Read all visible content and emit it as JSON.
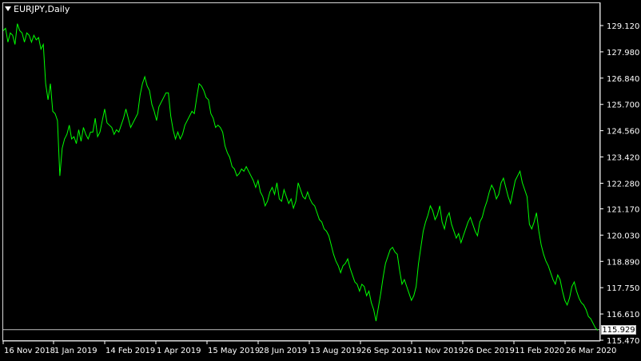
{
  "window": {
    "symbol_title": "EURJPY,Daily"
  },
  "colors": {
    "background": "#000000",
    "line": "#00ff00",
    "grid_frame": "#d8d8d8",
    "text": "#ffffff",
    "current_price_line": "#c0c0c0"
  },
  "current_price": "115.929",
  "chart_data": {
    "type": "line",
    "title": "EURJPY,Daily",
    "xlabel": "",
    "ylabel": "",
    "y_ticks": [
      "129.120",
      "127.980",
      "126.840",
      "125.700",
      "124.560",
      "123.420",
      "122.280",
      "121.170",
      "120.030",
      "118.890",
      "117.750",
      "116.610",
      "115.470"
    ],
    "x_ticks": [
      "16 Nov 2018",
      "1 Jan 2019",
      "14 Feb 2019",
      "1 Apr 2019",
      "15 May 2019",
      "28 Jun 2019",
      "13 Aug 2019",
      "26 Sep 2019",
      "11 Nov 2019",
      "26 Dec 2019",
      "11 Feb 2020",
      "26 Mar 2020"
    ],
    "ylim": [
      115.47,
      129.12
    ],
    "grid": false,
    "series": [
      {
        "values": [
          128.9,
          129.0,
          128.4,
          128.8,
          128.7,
          128.3,
          129.2,
          128.9,
          128.8,
          128.4,
          128.8,
          128.7,
          128.4,
          128.7,
          128.5,
          128.6,
          128.1,
          128.3,
          126.6,
          125.9,
          126.6,
          125.4,
          125.3,
          125.0,
          122.6,
          123.8,
          124.2,
          124.4,
          124.8,
          124.2,
          124.3,
          124.0,
          124.6,
          124.1,
          124.7,
          124.4,
          124.2,
          124.5,
          124.5,
          125.1,
          124.3,
          124.5,
          125.0,
          125.5,
          124.9,
          124.8,
          124.7,
          124.4,
          124.6,
          124.5,
          124.8,
          125.1,
          125.5,
          125.1,
          124.7,
          124.9,
          125.1,
          125.3,
          126.1,
          126.6,
          126.9,
          126.5,
          126.3,
          125.7,
          125.4,
          125.0,
          125.6,
          125.8,
          126.0,
          126.2,
          126.2,
          125.2,
          124.6,
          124.2,
          124.5,
          124.2,
          124.4,
          124.8,
          125.0,
          125.2,
          125.4,
          125.3,
          126.0,
          126.6,
          126.5,
          126.3,
          126.0,
          125.9,
          125.3,
          125.1,
          124.7,
          124.8,
          124.7,
          124.5,
          123.9,
          123.6,
          123.4,
          123.0,
          122.9,
          122.6,
          122.7,
          122.9,
          122.8,
          123.0,
          122.8,
          122.6,
          122.4,
          122.1,
          122.4,
          121.9,
          121.7,
          121.3,
          121.5,
          121.9,
          122.1,
          121.8,
          122.3,
          121.6,
          121.5,
          122.0,
          121.7,
          121.4,
          121.6,
          121.2,
          121.5,
          122.3,
          122.0,
          121.7,
          121.6,
          121.9,
          121.6,
          121.4,
          121.3,
          121.0,
          120.7,
          120.6,
          120.3,
          120.2,
          120.0,
          119.6,
          119.2,
          118.9,
          118.7,
          118.4,
          118.7,
          118.8,
          119.0,
          118.6,
          118.3,
          118.0,
          117.9,
          117.6,
          117.9,
          117.8,
          117.4,
          117.6,
          117.1,
          116.8,
          116.3,
          116.9,
          117.5,
          118.2,
          118.8,
          119.1,
          119.4,
          119.5,
          119.3,
          119.2,
          118.5,
          117.9,
          118.1,
          117.8,
          117.5,
          117.2,
          117.4,
          117.8,
          118.8,
          119.5,
          120.2,
          120.6,
          120.9,
          121.3,
          121.1,
          120.7,
          120.9,
          121.3,
          120.6,
          120.3,
          120.8,
          121.0,
          120.5,
          120.2,
          119.9,
          120.1,
          119.7,
          120.0,
          120.3,
          120.6,
          120.8,
          120.5,
          120.2,
          120.0,
          120.6,
          120.8,
          121.2,
          121.5,
          121.9,
          122.2,
          122.0,
          121.6,
          121.8,
          122.3,
          122.5,
          122.1,
          121.7,
          121.4,
          121.9,
          122.4,
          122.6,
          122.8,
          122.3,
          122.0,
          121.7,
          120.5,
          120.3,
          120.6,
          121.0,
          120.2,
          119.6,
          119.2,
          118.9,
          118.7,
          118.4,
          118.1,
          117.9,
          118.3,
          118.1,
          117.6,
          117.2,
          117.0,
          117.3,
          117.8,
          118.0,
          117.6,
          117.3,
          117.1,
          117.0,
          116.8,
          116.5,
          116.4,
          116.2,
          116.0,
          115.9
        ],
        "display_values": [
          128.9,
          129.0,
          128.4,
          128.8,
          128.7,
          128.3,
          129.2,
          128.9,
          128.8,
          128.4,
          128.8,
          128.7,
          128.4,
          128.7,
          128.5,
          128.6,
          128.1,
          128.3,
          126.6,
          125.9,
          126.6,
          125.4,
          125.3,
          125.0,
          122.6,
          123.8,
          124.2,
          124.4,
          124.8,
          124.2,
          124.3,
          124.0,
          124.6,
          124.1,
          124.7,
          124.4,
          124.2,
          124.5,
          124.5,
          125.1,
          124.3,
          124.5,
          125.0,
          125.5,
          124.9,
          124.8,
          124.7,
          124.4,
          124.6,
          124.5,
          124.8,
          125.1,
          125.5,
          125.1,
          124.7,
          124.9,
          125.1,
          125.3,
          126.1,
          126.6,
          126.9,
          126.5,
          126.3,
          125.7,
          125.4,
          125.0,
          125.6,
          125.8,
          126.0,
          126.2,
          126.2,
          125.2,
          124.6,
          124.2,
          124.5,
          124.2,
          124.4,
          124.8,
          125.0,
          125.2,
          125.4,
          125.3,
          126.0,
          126.6,
          126.5,
          126.3,
          126.0,
          125.9,
          125.3,
          125.1,
          124.7,
          124.8,
          124.7,
          124.5,
          123.9,
          123.6,
          123.4,
          123.0,
          122.9,
          122.6,
          122.7,
          122.9,
          122.8,
          123.0,
          122.8,
          122.6,
          122.4,
          122.1,
          122.4,
          121.9,
          121.7,
          121.3,
          121.5,
          121.9,
          122.1,
          121.8,
          122.3,
          121.6,
          121.5,
          122.0,
          121.7,
          121.4,
          121.6,
          121.2,
          121.5,
          122.3,
          122.0,
          121.7,
          121.6,
          121.9,
          121.6,
          121.4,
          121.3,
          121.0,
          120.7,
          120.6,
          120.3,
          120.2,
          120.0,
          119.6,
          119.2,
          118.9,
          118.7,
          118.4,
          118.7,
          118.8,
          119.0,
          118.6,
          118.3,
          118.0,
          117.9,
          117.6,
          117.9,
          117.8,
          117.4,
          117.6,
          117.1,
          116.8,
          116.3,
          116.9,
          117.5,
          118.2,
          118.8,
          119.1,
          119.4,
          119.5,
          119.3,
          119.2,
          118.5,
          117.9,
          118.1,
          117.8,
          117.5,
          117.2,
          117.4,
          117.8,
          118.8,
          119.5,
          120.2,
          120.6,
          120.9,
          121.3,
          121.1,
          120.7,
          120.9,
          121.3,
          120.6,
          120.3,
          120.8,
          121.0,
          120.5,
          120.2,
          119.9,
          120.1,
          119.7,
          120.0,
          120.3,
          120.6,
          120.8,
          120.5,
          120.2,
          120.0,
          120.6,
          120.8,
          121.2,
          121.5,
          121.9,
          122.2,
          122.0,
          121.6,
          121.8,
          122.3,
          122.5,
          122.1,
          121.7,
          121.4,
          121.9,
          122.4,
          122.6,
          122.8,
          122.3,
          122.0,
          121.7,
          120.5,
          120.3,
          120.6,
          121.0,
          120.2,
          119.6,
          119.2,
          118.9,
          118.7,
          118.4,
          118.1,
          117.9,
          118.3,
          118.1,
          117.6,
          117.2,
          117.0,
          117.3,
          117.8,
          118.0,
          117.6,
          117.3,
          117.1,
          117.0,
          116.8,
          116.5,
          116.4,
          116.2,
          116.0,
          115.9
        ]
      }
    ]
  }
}
